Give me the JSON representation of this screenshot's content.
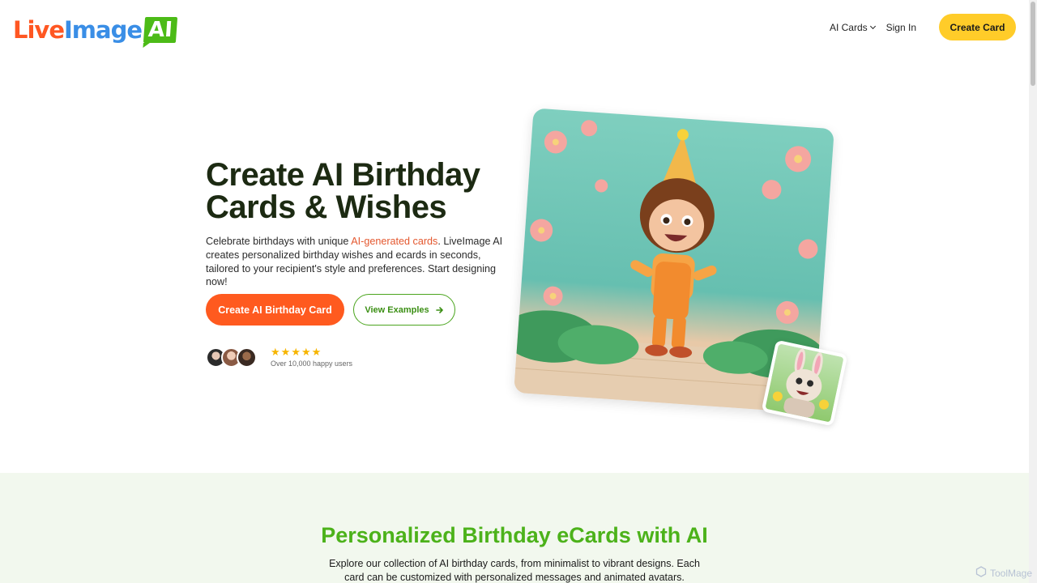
{
  "header": {
    "logo": {
      "part1": "Live",
      "part2": "Image",
      "part3": "AI"
    },
    "nav": {
      "ai_cards": "AI Cards",
      "sign_in": "Sign In",
      "create_card": "Create Card"
    }
  },
  "hero": {
    "title_line1": "Create AI Birthday",
    "title_line2": "Cards & Wishes",
    "desc_before": "Celebrate birthdays with unique ",
    "desc_link": "AI-generated cards",
    "desc_after": ". LiveImage AI creates personalized birthday wishes and ecards in seconds, tailored to your recipient's style and preferences. Start designing now!",
    "primary_button": "Create AI Birthday Card",
    "secondary_button": "View Examples",
    "rating_stars": 5,
    "social_proof": "Over 10,000 happy users"
  },
  "section2": {
    "title": "Personalized Birthday eCards with AI",
    "desc": "Explore our collection of AI birthday cards, from minimalist to vibrant designs. Each card can be customized with personalized messages and animated avatars."
  },
  "watermark": "ToolMage",
  "colors": {
    "accent_orange": "#ff5a1f",
    "accent_green": "#4cb21a",
    "accent_yellow": "#ffcc29"
  }
}
